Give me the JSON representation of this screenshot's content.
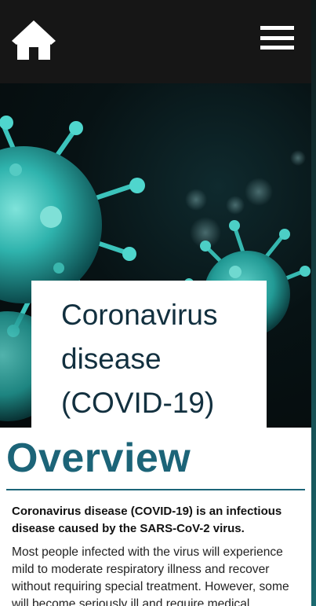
{
  "header": {
    "home_icon": "home-icon",
    "menu_icon": "hamburger-menu-icon"
  },
  "hero": {
    "image": "coronavirus-particles-illustration",
    "title": "Coronavirus disease (COVID-19)"
  },
  "section": {
    "heading": "Overview",
    "lead": "Coronavirus disease (COVID-19) is an infectious disease caused by the SARS-CoV-2 virus.",
    "body": "Most people infected with the virus will experience mild to moderate respiratory illness and recover without requiring special treatment. However, some will become seriously ill and require medical"
  },
  "colors": {
    "header_bg": "#161616",
    "heading": "#1c6478",
    "title": "#12303f",
    "virus": "#2fb3ad"
  }
}
